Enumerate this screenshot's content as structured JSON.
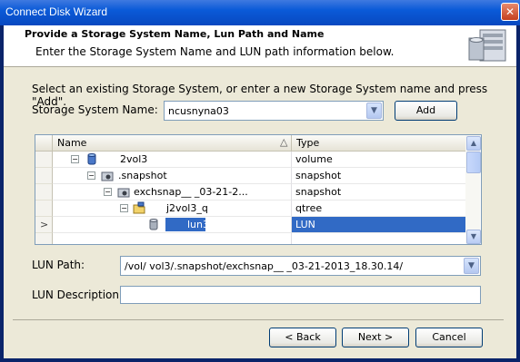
{
  "window": {
    "title": "Connect Disk Wizard",
    "close_glyph": "✕"
  },
  "header": {
    "title": "Provide a Storage System Name, Lun Path and Name",
    "subtitle": "Enter the Storage System Name and LUN path information below."
  },
  "instruction": "Select an existing Storage System, or enter a new Storage System name and press \"Add\".",
  "storage_system": {
    "label": "Storage System Name:",
    "value": "ncusnyna03",
    "add_label": "Add"
  },
  "tree": {
    "columns": [
      {
        "label": "Name",
        "sort_glyph": "△"
      },
      {
        "label": "Type"
      }
    ],
    "rows": [
      {
        "name": "2vol3",
        "type": "volume",
        "icon": "volume-icon",
        "expander": "−",
        "selected": false
      },
      {
        "name": ".snapshot",
        "type": "snapshot",
        "icon": "snapshot-folder-icon",
        "expander": "−",
        "selected": false
      },
      {
        "name": "exchsnap__                 _03-21-2...",
        "type": "snapshot",
        "icon": "snapshot-folder-icon",
        "expander": "−",
        "selected": false
      },
      {
        "name": "j2vol3_q",
        "type": "qtree",
        "icon": "qtree-icon",
        "expander": "−",
        "selected": false
      },
      {
        "name": "lun3",
        "type": "LUN",
        "icon": "lun-icon",
        "expander": "",
        "selected": true
      }
    ],
    "current_row_glyph": ">"
  },
  "lun_path": {
    "label": "LUN Path:",
    "value": "/vol/        vol3/.snapshot/exchsnap__                      _03-21-2013_18.30.14/"
  },
  "lun_description": {
    "label": "LUN Description:",
    "value": ""
  },
  "buttons": {
    "back": "< Back",
    "next": "Next >",
    "cancel": "Cancel"
  },
  "colors": {
    "selection": "#316ac5",
    "titlebar": "#0a5ad8",
    "client": "#ece9d8"
  }
}
